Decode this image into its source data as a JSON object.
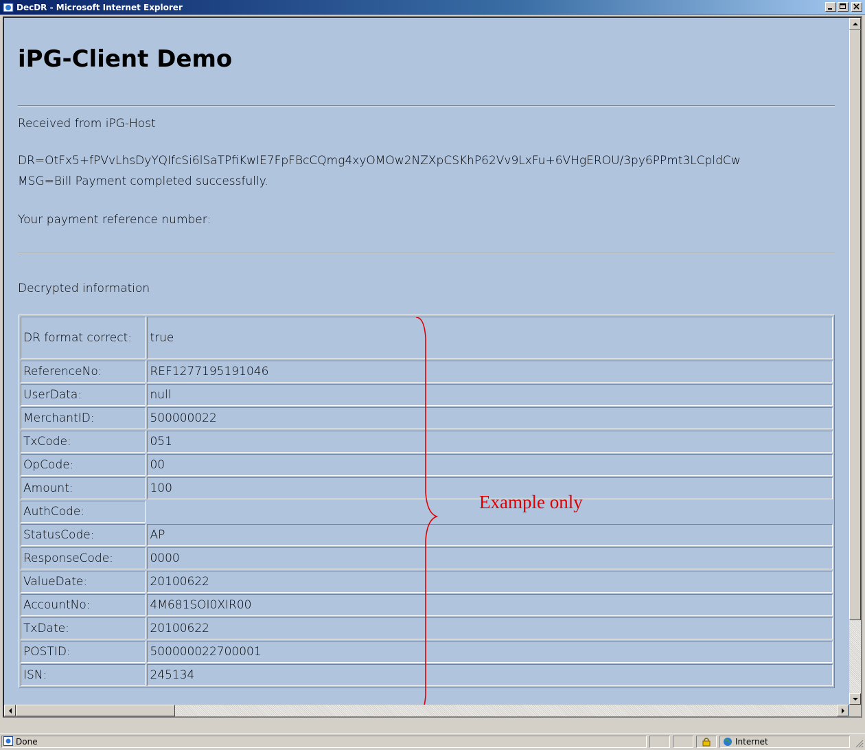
{
  "window": {
    "title": "DecDR - Microsoft Internet Explorer"
  },
  "page": {
    "heading": "iPG-Client Demo",
    "received_from": "Received from iPG-Host",
    "dr_line": "DR=OtFx5+fPVvLhsDyYQIfcSi6lSaTPfiKwIE7FpFBcCQmg4xyOMOw2NZXpCSKhP62Vv9LxFu+6VHgEROU/3py6PPmt3LCpldCw",
    "msg_line": "MSG=Bill Payment completed successfully.",
    "payment_ref_label": "Your payment reference number:",
    "decrypted_label": "Decrypted information",
    "annotation": "Example only"
  },
  "table": {
    "rows": [
      {
        "label": "DR format correct:",
        "value": "true"
      },
      {
        "label": "ReferenceNo:",
        "value": "REF1277195191046"
      },
      {
        "label": "UserData:",
        "value": "null"
      },
      {
        "label": "MerchantID:",
        "value": "500000022"
      },
      {
        "label": "TxCode:",
        "value": "051"
      },
      {
        "label": "OpCode:",
        "value": "00"
      },
      {
        "label": "Amount:",
        "value": "100"
      },
      {
        "label": "AuthCode:",
        "value": ""
      },
      {
        "label": "StatusCode:",
        "value": "AP"
      },
      {
        "label": "ResponseCode:",
        "value": "0000"
      },
      {
        "label": "ValueDate:",
        "value": "20100622"
      },
      {
        "label": "AccountNo:",
        "value": "4M681SOI0XIR00"
      },
      {
        "label": "TxDate:",
        "value": "20100622"
      },
      {
        "label": "POSTID:",
        "value": "500000022700001"
      },
      {
        "label": "ISN:",
        "value": "245134"
      }
    ]
  },
  "statusbar": {
    "status": "Done",
    "zone": "Internet"
  },
  "colors": {
    "page_background": "#b0c4de",
    "annotation": "#e00000",
    "titlebar": "#0a246a"
  }
}
